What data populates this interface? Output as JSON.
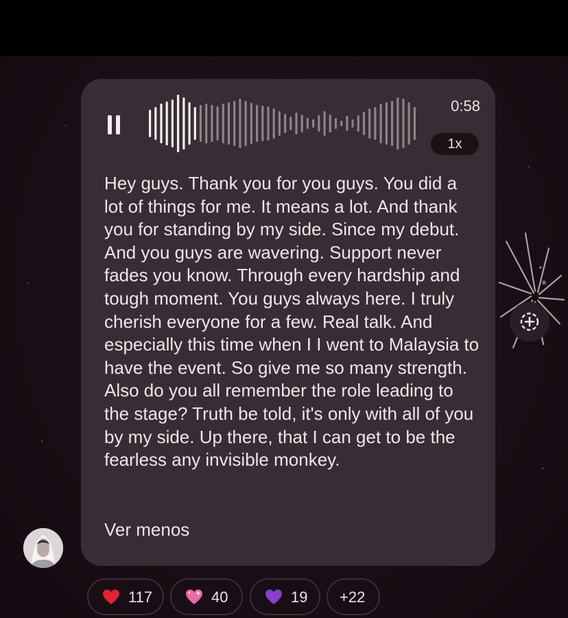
{
  "voice_message": {
    "duration": "0:58",
    "playback_speed": "1x",
    "state": "playing",
    "progress": 0.18,
    "transcript": "Hey guys. Thank you for you guys. You did a lot of things for me. It means a lot. And thank you for standing by my side. Since my debut. And you guys are wavering. Support never fades you know. Through every hardship and tough moment. You guys always here. I truly cherish everyone for a few. Real talk. And especially this time when I I went to Malaysia to have the event. So give me so many strength. Also do you all remember the role leading to the stage? Truth be told, it's only with all of you by my side. Up there, that I can get to be the fearless any invisible monkey.",
    "see_less_label": "Ver menos"
  },
  "reactions": [
    {
      "emoji": "red-heart",
      "count": "117"
    },
    {
      "emoji": "sparkling-heart",
      "count": "40"
    },
    {
      "emoji": "purple-heart",
      "count": "19"
    },
    {
      "more_label": "+22"
    }
  ],
  "colors": {
    "bubble_bg": "#3a2c34",
    "waveform_played": "#f4f0f2",
    "waveform_unplayed": "#8f8289",
    "speed_pill_bg": "#1a1217",
    "red_heart": "#e0242f",
    "pink_heart": "#e66aa8",
    "purple_heart": "#8a3fd1"
  }
}
